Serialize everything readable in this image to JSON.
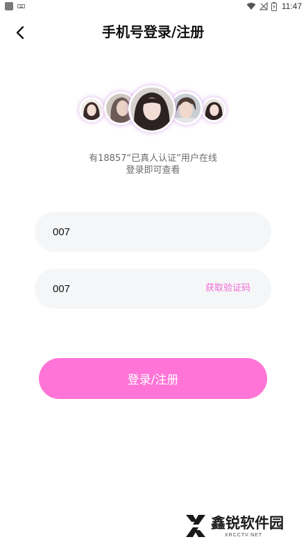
{
  "status_bar": {
    "time": "11:47",
    "icons": [
      "app-icon",
      "keyboard-icon",
      "wifi-icon",
      "no-signal-icon",
      "battery-icon"
    ]
  },
  "header": {
    "back_icon": "chevron-left-icon",
    "title": "手机号登录/注册"
  },
  "avatars": [
    "avatar-1",
    "avatar-2",
    "avatar-3",
    "avatar-4",
    "avatar-5"
  ],
  "subtitle": {
    "line1": "有18857“已真人认证”用户在线",
    "line2": "登录即可查看"
  },
  "form": {
    "phone_value": "007",
    "code_value": "007",
    "get_code_label": "获取验证码",
    "get_code_color": "#f06ad2"
  },
  "login_button": {
    "label": "登录/注册",
    "color": "#ff74d6"
  },
  "watermark": {
    "text": "鑫锐软件园",
    "sub": "XRCCTV.NET"
  }
}
